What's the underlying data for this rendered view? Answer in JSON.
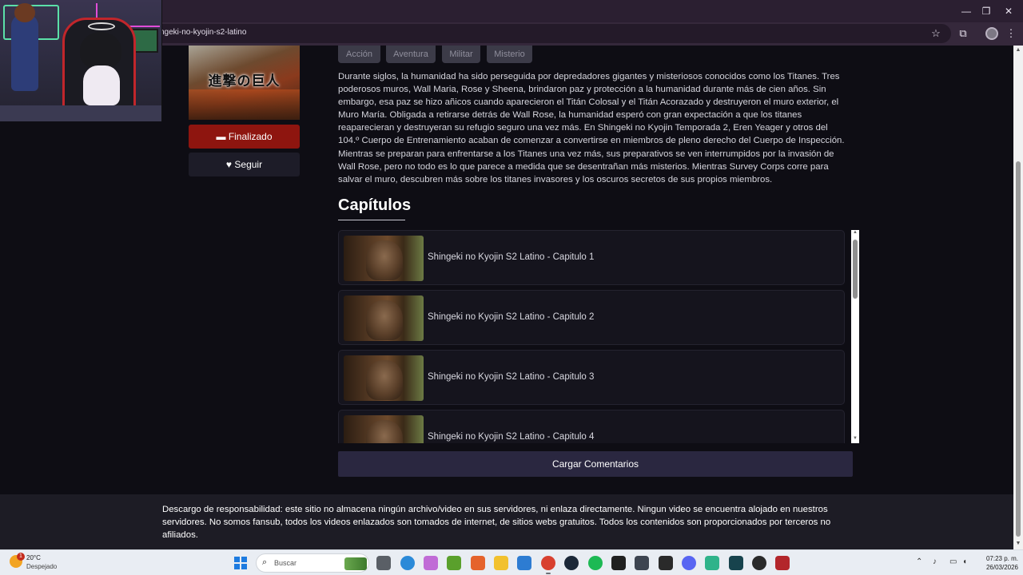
{
  "browser": {
    "url": "ngeki-no-kyojin-s2-latino",
    "window_controls": {
      "minimize": "—",
      "maximize": "❐",
      "close": "✕"
    },
    "toolbar_icons": {
      "bookmark": "☆",
      "extensions": "⧉",
      "menu": "⋮"
    }
  },
  "anime": {
    "cover_kanji": "進撃の巨人",
    "status_label": "Finalizado",
    "follow_label": "Seguir",
    "genres": [
      "Acción",
      "Aventura",
      "Militar",
      "Misterio"
    ],
    "synopsis": "Durante siglos, la humanidad ha sido perseguida por depredadores gigantes y misteriosos conocidos como los Titanes. Tres poderosos muros, Wall Maria, Rose y Sheena, brindaron paz y protección a la humanidad durante más de cien años. Sin embargo, esa paz se hizo añicos cuando aparecieron el Titán Colosal y el Titán Acorazado y destruyeron el muro exterior, el Muro María. Obligada a retirarse detrás de Wall Rose, la humanidad esperó con gran expectación a que los titanes reaparecieran y destruyeran su refugio seguro una vez más. En Shingeki no Kyojin Temporada 2, Eren Yeager y otros del 104.º Cuerpo de Entrenamiento acaban de comenzar a convertirse en miembros de pleno derecho del Cuerpo de Inspección. Mientras se preparan para enfrentarse a los Titanes una vez más, sus preparativos se ven interrumpidos por la invasión de Wall Rose, pero no todo es lo que parece a medida que se desentrañan más misterios. Mientras Survey Corps corre para salvar el muro, descubren más sobre los titanes invasores y los oscuros secretos de sus propios miembros."
  },
  "chapters": {
    "heading": "Capítulos",
    "items": [
      {
        "title": "Shingeki no Kyojin S2 Latino - Capitulo 1"
      },
      {
        "title": "Shingeki no Kyojin S2 Latino - Capitulo 2"
      },
      {
        "title": "Shingeki no Kyojin S2 Latino - Capitulo 3"
      },
      {
        "title": "Shingeki no Kyojin S2 Latino - Capitulo 4"
      }
    ]
  },
  "comments_button": "Cargar Comentarios",
  "footer": {
    "disclaimer": "Descargo de responsabilidad: este sitio no almacena ningún archivo/video en sus servidores, ni enlaza directamente. Ningun video se encuentra alojado en nuestros servidores. No somos fansub, todos los videos enlazados son tomados de internet, de sitios webs gratuitos. Todos los contenidos son proporcionados por terceros no afiliados."
  },
  "taskbar": {
    "weather": {
      "temp": "20°C",
      "desc": "Despejado",
      "badge": "1"
    },
    "search_label": "Buscar",
    "clock": {
      "time": "07:23 p. m.",
      "date": "26/03/2026"
    }
  },
  "colors": {
    "status_button": "#8e150f",
    "comments_button": "#2a2740",
    "page_bg": "#0e0d14",
    "browser_frame": "#35283b"
  }
}
